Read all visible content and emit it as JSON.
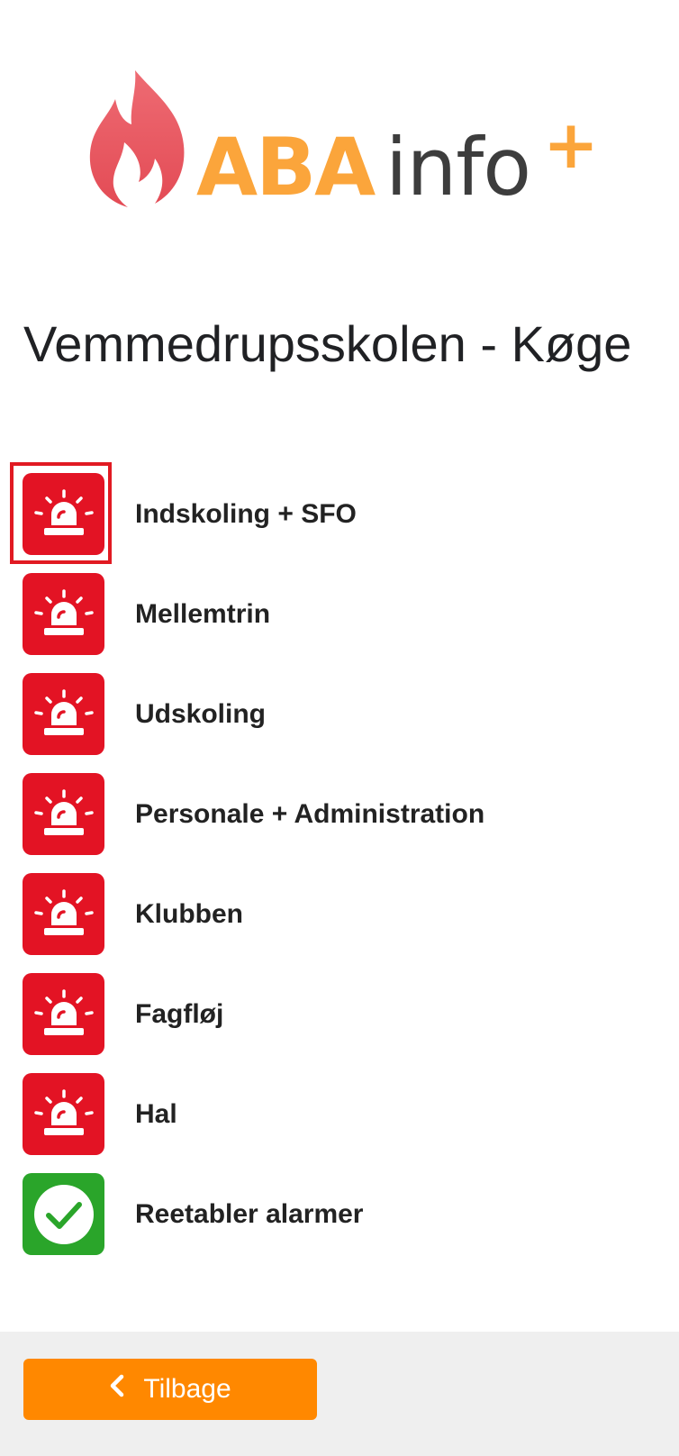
{
  "logo": {
    "text_primary": "ABA",
    "text_secondary": "info",
    "text_plus": "+",
    "colors": {
      "flame": "#e8545c",
      "primary": "#fba53b",
      "secondary": "#3d3d3d"
    }
  },
  "page": {
    "title": "Vemmedrupsskolen - Køge"
  },
  "alarms": [
    {
      "label": "Indskoling + SFO",
      "icon": "siren-icon",
      "status": "alarm",
      "focused": true
    },
    {
      "label": "Mellemtrin",
      "icon": "siren-icon",
      "status": "alarm"
    },
    {
      "label": "Udskoling",
      "icon": "siren-icon",
      "status": "alarm"
    },
    {
      "label": "Personale + Administration",
      "icon": "siren-icon",
      "status": "alarm"
    },
    {
      "label": "Klubben",
      "icon": "siren-icon",
      "status": "alarm"
    },
    {
      "label": "Fagfløj",
      "icon": "siren-icon",
      "status": "alarm"
    },
    {
      "label": "Hal",
      "icon": "siren-icon",
      "status": "alarm"
    },
    {
      "label": "Reetabler alarmer",
      "icon": "checkmark-icon",
      "status": "reset"
    }
  ],
  "footer": {
    "back_label": "Tilbage",
    "back_icon": "chevron-left-icon"
  },
  "colors": {
    "alarm_red": "#e31324",
    "reset_green": "#2aa52a",
    "button_orange": "#ff8800",
    "footer_bg": "#efefef"
  }
}
